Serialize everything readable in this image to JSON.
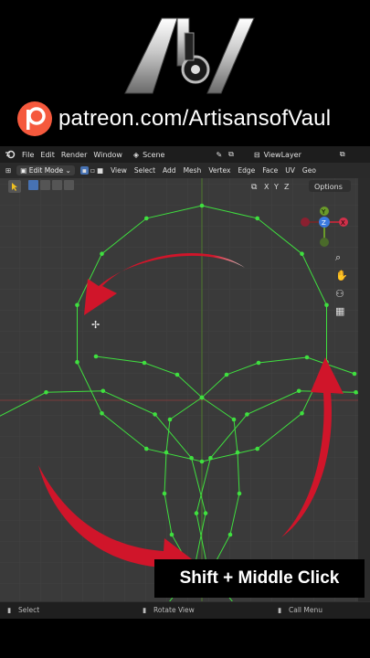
{
  "branding": {
    "patreon_url": "patreon.com/ArtisansofVaul"
  },
  "menubar": {
    "items": [
      "File",
      "Edit",
      "Render",
      "Window"
    ],
    "scene": "Scene",
    "view_layer": "ViewLayer"
  },
  "toolbar": {
    "mode": "Edit Mode",
    "menus": [
      "View",
      "Select",
      "Add",
      "Mesh",
      "Vertex",
      "Edge",
      "Face",
      "UV",
      "Geo"
    ],
    "axes": [
      "X",
      "Y",
      "Z"
    ],
    "options": "Options"
  },
  "gizmo": {
    "y": "Y",
    "z": "Z",
    "x": "X"
  },
  "statusbar": {
    "select": "Select",
    "rotate": "Rotate View",
    "call_menu": "Call Menu"
  },
  "caption": "Shift + Middle Click",
  "colors": {
    "accent_red": "#d0152a",
    "mesh_green": "#3fe03f",
    "grid": "#444444"
  }
}
